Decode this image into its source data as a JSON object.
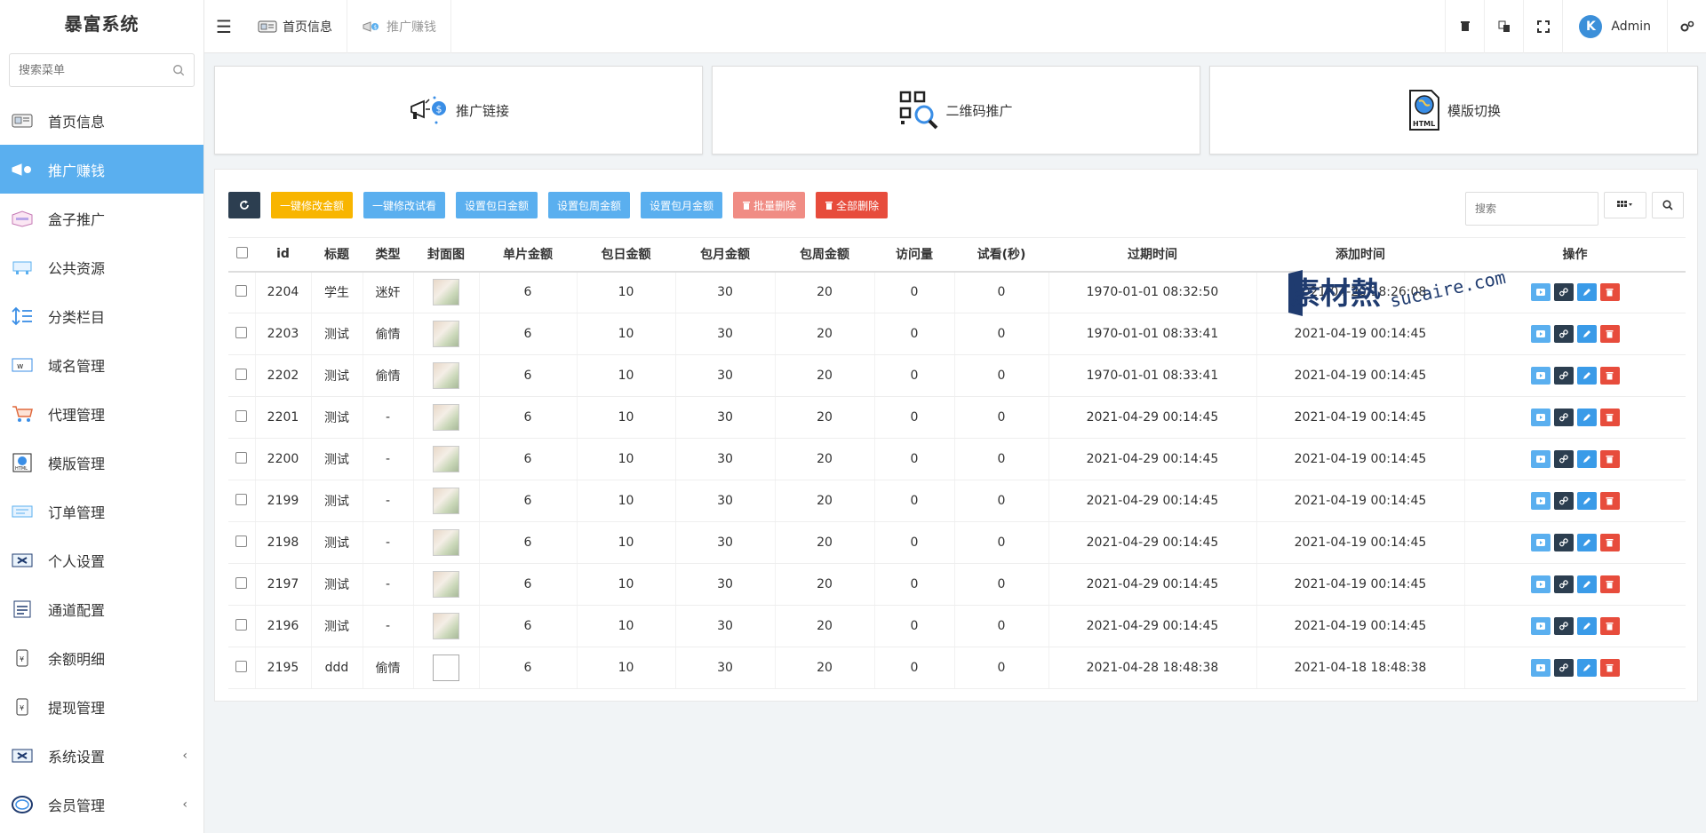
{
  "app": {
    "title": "暴富系统"
  },
  "sidebar": {
    "search_placeholder": "搜索菜单",
    "items": [
      {
        "label": "首页信息",
        "icon": "dashboard-icon",
        "active": false
      },
      {
        "label": "推广赚钱",
        "icon": "megaphone-icon",
        "active": true
      },
      {
        "label": "盒子推广",
        "icon": "box-icon",
        "active": false
      },
      {
        "label": "公共资源",
        "icon": "resource-icon",
        "active": false
      },
      {
        "label": "分类栏目",
        "icon": "sort-icon",
        "active": false
      },
      {
        "label": "域名管理",
        "icon": "domain-icon",
        "active": false
      },
      {
        "label": "代理管理",
        "icon": "cart-icon",
        "active": false
      },
      {
        "label": "模版管理",
        "icon": "html-icon",
        "active": false
      },
      {
        "label": "订单管理",
        "icon": "order-icon",
        "active": false
      },
      {
        "label": "个人设置",
        "icon": "settings-icon",
        "active": false
      },
      {
        "label": "通道配置",
        "icon": "channel-icon",
        "active": false
      },
      {
        "label": "余额明细",
        "icon": "balance-icon",
        "active": false
      },
      {
        "label": "提现管理",
        "icon": "withdraw-icon",
        "active": false
      },
      {
        "label": "系统设置",
        "icon": "system-icon",
        "active": false,
        "has_arrow": true
      },
      {
        "label": "会员管理",
        "icon": "member-icon",
        "active": false,
        "has_arrow": true
      }
    ]
  },
  "topbar": {
    "tabs": [
      {
        "label": "首页信息"
      },
      {
        "label": "推广赚钱"
      }
    ],
    "user": "Admin"
  },
  "cards": [
    {
      "label": "推广链接",
      "icon": "promo-link-icon"
    },
    {
      "label": "二维码推广",
      "icon": "qrcode-icon"
    },
    {
      "label": "模版切换",
      "icon": "html-file-icon"
    }
  ],
  "toolbar": {
    "btn1": "一键修改金额",
    "btn2": "一键修改试看",
    "btn3": "设置包日金额",
    "btn4": "设置包周金额",
    "btn5": "设置包月金额",
    "btn6": "批量删除",
    "btn7": "全部删除",
    "search_placeholder": "搜索"
  },
  "table": {
    "headers": [
      "id",
      "标题",
      "类型",
      "封面图",
      "单片金额",
      "包日金额",
      "包月金额",
      "包周金额",
      "访问量",
      "试看(秒)",
      "过期时间",
      "添加时间",
      "操作"
    ],
    "rows": [
      {
        "id": "2204",
        "title": "学生",
        "type": "迷奸",
        "single": "6",
        "day": "10",
        "month": "30",
        "week": "20",
        "visits": "0",
        "trial": "0",
        "expire": "1970-01-01 08:32:50",
        "added": "2021-04-20 18:26:08",
        "img": true
      },
      {
        "id": "2203",
        "title": "测试",
        "type": "偷情",
        "single": "6",
        "day": "10",
        "month": "30",
        "week": "20",
        "visits": "0",
        "trial": "0",
        "expire": "1970-01-01 08:33:41",
        "added": "2021-04-19 00:14:45",
        "img": true
      },
      {
        "id": "2202",
        "title": "测试",
        "type": "偷情",
        "single": "6",
        "day": "10",
        "month": "30",
        "week": "20",
        "visits": "0",
        "trial": "0",
        "expire": "1970-01-01 08:33:41",
        "added": "2021-04-19 00:14:45",
        "img": true
      },
      {
        "id": "2201",
        "title": "测试",
        "type": "-",
        "single": "6",
        "day": "10",
        "month": "30",
        "week": "20",
        "visits": "0",
        "trial": "0",
        "expire": "2021-04-29 00:14:45",
        "added": "2021-04-19 00:14:45",
        "img": true
      },
      {
        "id": "2200",
        "title": "测试",
        "type": "-",
        "single": "6",
        "day": "10",
        "month": "30",
        "week": "20",
        "visits": "0",
        "trial": "0",
        "expire": "2021-04-29 00:14:45",
        "added": "2021-04-19 00:14:45",
        "img": true
      },
      {
        "id": "2199",
        "title": "测试",
        "type": "-",
        "single": "6",
        "day": "10",
        "month": "30",
        "week": "20",
        "visits": "0",
        "trial": "0",
        "expire": "2021-04-29 00:14:45",
        "added": "2021-04-19 00:14:45",
        "img": true
      },
      {
        "id": "2198",
        "title": "测试",
        "type": "-",
        "single": "6",
        "day": "10",
        "month": "30",
        "week": "20",
        "visits": "0",
        "trial": "0",
        "expire": "2021-04-29 00:14:45",
        "added": "2021-04-19 00:14:45",
        "img": true
      },
      {
        "id": "2197",
        "title": "测试",
        "type": "-",
        "single": "6",
        "day": "10",
        "month": "30",
        "week": "20",
        "visits": "0",
        "trial": "0",
        "expire": "2021-04-29 00:14:45",
        "added": "2021-04-19 00:14:45",
        "img": true
      },
      {
        "id": "2196",
        "title": "测试",
        "type": "-",
        "single": "6",
        "day": "10",
        "month": "30",
        "week": "20",
        "visits": "0",
        "trial": "0",
        "expire": "2021-04-29 00:14:45",
        "added": "2021-04-19 00:14:45",
        "img": true
      },
      {
        "id": "2195",
        "title": "ddd",
        "type": "偷情",
        "single": "6",
        "day": "10",
        "month": "30",
        "week": "20",
        "visits": "0",
        "trial": "0",
        "expire": "2021-04-28 18:48:38",
        "added": "2021-04-18 18:48:38",
        "img": false
      }
    ]
  },
  "watermark": {
    "cn": "素材熱",
    "en": "sucaire.com"
  }
}
